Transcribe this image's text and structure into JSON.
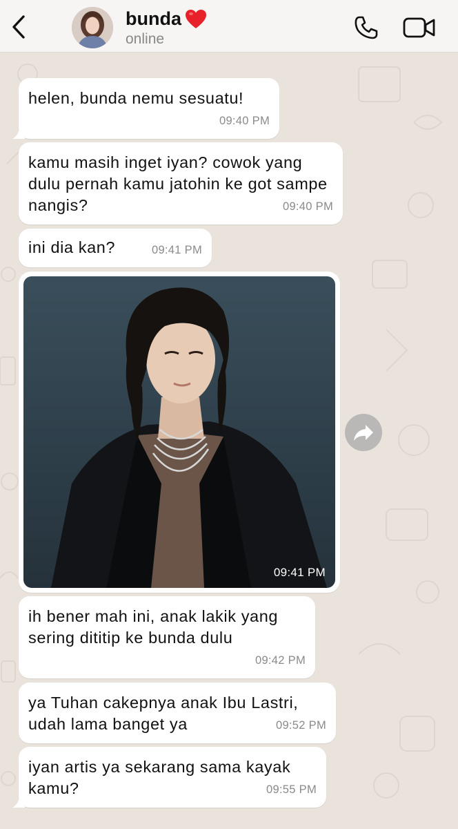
{
  "header": {
    "back_icon": "chevron-left-icon",
    "contact_name": "bunda",
    "contact_emoji": "❤️",
    "status": "online",
    "call_icon": "phone-icon",
    "video_icon": "video-camera-icon"
  },
  "colors": {
    "header_bg": "#f6f5f3",
    "wallpaper": "#e9e3dc",
    "bubble": "#ffffff",
    "heart": "#e8202a"
  },
  "messages": [
    {
      "text": "helen, bunda nemu sesuatu!",
      "time": "09:40 PM"
    },
    {
      "text": "kamu masih inget iyan? cowok yang dulu pernah kamu jatohin ke got sampe nangis?",
      "time": "09:40 PM"
    },
    {
      "text": "ini dia kan?",
      "time": "09:41 PM"
    },
    {
      "type": "image",
      "time": "09:41 PM"
    },
    {
      "text": "ih bener mah ini, anak lakik yang sering dititip ke bunda dulu",
      "time": "09:42 PM"
    },
    {
      "text": "ya Tuhan cakepnya anak Ibu Lastri, udah lama banget ya",
      "time": "09:52 PM"
    },
    {
      "text": "iyan artis ya sekarang sama kayak kamu?",
      "time": "09:55 PM"
    }
  ],
  "forward_icon": "share-arrow-icon"
}
